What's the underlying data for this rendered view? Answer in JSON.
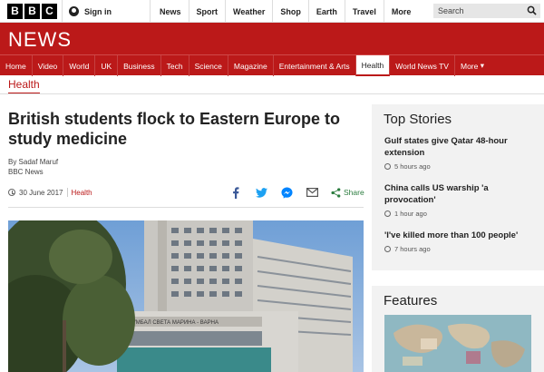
{
  "topbar": {
    "logo_letters": [
      "B",
      "B",
      "C"
    ],
    "signin_label": "Sign in",
    "nav": [
      "News",
      "Sport",
      "Weather",
      "Shop",
      "Earth",
      "Travel"
    ],
    "more_label": "More",
    "search_placeholder": "Search"
  },
  "masthead": {
    "title": "NEWS",
    "sections": [
      "Home",
      "Video",
      "World",
      "UK",
      "Business",
      "Tech",
      "Science",
      "Magazine",
      "Entertainment & Arts",
      "Health",
      "World News TV",
      "More"
    ],
    "active_section": "Health",
    "more_arrow": "▾"
  },
  "article": {
    "section": "Health",
    "headline": "British students flock to Eastern Europe to study medicine",
    "author": "By Sadaf Maruf",
    "source": "BBC News",
    "date": "30 June 2017",
    "tag": "Health",
    "share_label": "Share",
    "image_sign": "УМБАЛ СВЕТА МАРИНА - ВАРНА"
  },
  "sidebar": {
    "top_stories_title": "Top Stories",
    "stories": [
      {
        "title": "Gulf states give Qatar 48-hour extension",
        "time": "5 hours ago"
      },
      {
        "title": "China calls US warship 'a provocation'",
        "time": "1 hour ago"
      },
      {
        "title": "'I've killed more than 100 people'",
        "time": "7 hours ago"
      }
    ],
    "features_title": "Features"
  },
  "colors": {
    "brand_red": "#bb1919",
    "share_green": "#2b7c3e",
    "facebook": "#3b5998",
    "twitter": "#1da1f2",
    "messenger": "#0084ff"
  }
}
